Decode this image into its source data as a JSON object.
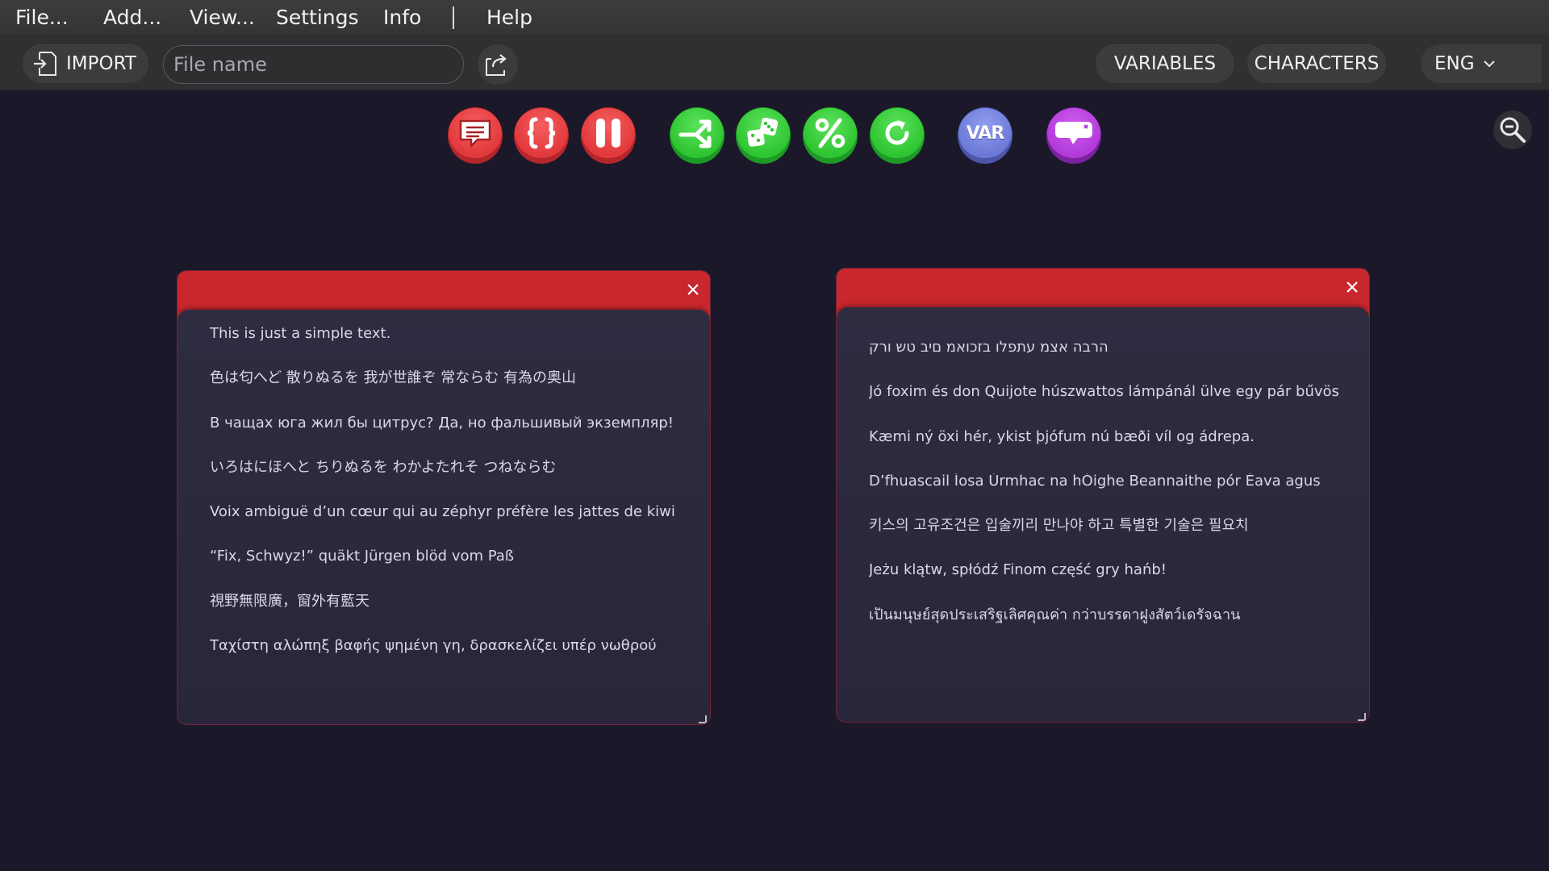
{
  "menu": {
    "items": [
      {
        "id": "file",
        "label": "File..."
      },
      {
        "id": "add",
        "label": "Add..."
      },
      {
        "id": "view",
        "label": "View..."
      },
      {
        "id": "settings",
        "label": "Settings"
      },
      {
        "id": "info",
        "label": "Info"
      },
      {
        "id": "help",
        "label": "Help"
      }
    ],
    "separator": "|"
  },
  "toolbar": {
    "import_label": "IMPORT",
    "file_name_placeholder": "File name",
    "file_name_value": "",
    "variables_label": "VARIABLES",
    "characters_label": "CHARACTERS",
    "language_label": "ENG"
  },
  "palette": {
    "buttons": [
      {
        "name": "text-node-button",
        "icon": "speech-bubble-icon",
        "color": "#e2393c"
      },
      {
        "name": "script-node-button",
        "icon": "braces-icon",
        "color": "#e2393c"
      },
      {
        "name": "pause-node-button",
        "icon": "pause-icon",
        "color": "#e2393c"
      },
      {
        "name": "branch-node-button",
        "icon": "split-arrow-icon",
        "color": "#2fc532"
      },
      {
        "name": "random-node-button",
        "icon": "dice-icon",
        "color": "#2fc532"
      },
      {
        "name": "chance-node-button",
        "icon": "percent-icon",
        "color": "#2fc532"
      },
      {
        "name": "repeat-node-button",
        "icon": "refresh-icon",
        "color": "#2fc532"
      },
      {
        "name": "variable-node-button",
        "icon": "var-badge-icon",
        "color": "#6c79d6",
        "label": "VAR"
      },
      {
        "name": "comment-node-button",
        "icon": "comment-bubble-icon",
        "color": "#b13bd8"
      }
    ]
  },
  "nodes": [
    {
      "header_color": "#c8272d",
      "lines": [
        "This is just a simple text.",
        "色は匂へど 散りぬるを 我が世誰ぞ 常ならむ 有為の奥山",
        "В чащах юга жил бы цитрус? Да, но фальшивый экземпляр!",
        "いろはにほへと ちりぬるを わかよたれそ つねならむ",
        "Voix ambiguë d’un cœur qui au zéphyr préfère les jattes de kiwi",
        "“Fix, Schwyz!” quäkt Jürgen blöd vom Paß",
        "視野無限廣，窗外有藍天",
        "Ταχίστη αλώπηξ βαφής ψημένη γη, δρασκελίζει υπέρ νωθρού"
      ]
    },
    {
      "header_color": "#c8272d",
      "lines": [
        "הרבה אצמ עתפלו בזכואמ םיב טש ורק",
        "Jó foxim és don Quijote húszwattos lámpánál ülve egy pár bűvös",
        "Kæmi ný öxi hér, ykist þjófum nú bæði víl og ádrepa.",
        "D’fhuascail Íosa Úrmhac na hÓighe Beannaithe pór Éava agus",
        "키스의 고유조건은 입술끼리 만나야 하고 특별한 기술은 필요치",
        "Jeżu klątw, spłódź Finom część gry hańb!",
        "เป็นมนุษย์สุดประเสริฐเลิศคุณค่า กว่าบรรดาฝูงสัตว์เดรัจฉาน"
      ]
    }
  ],
  "colors": {
    "background": "#1b1829",
    "menubar": "#3a3a3c",
    "toolbar": "#303032",
    "node_header": "#c8272d",
    "node_body": "#2d2a3f"
  }
}
